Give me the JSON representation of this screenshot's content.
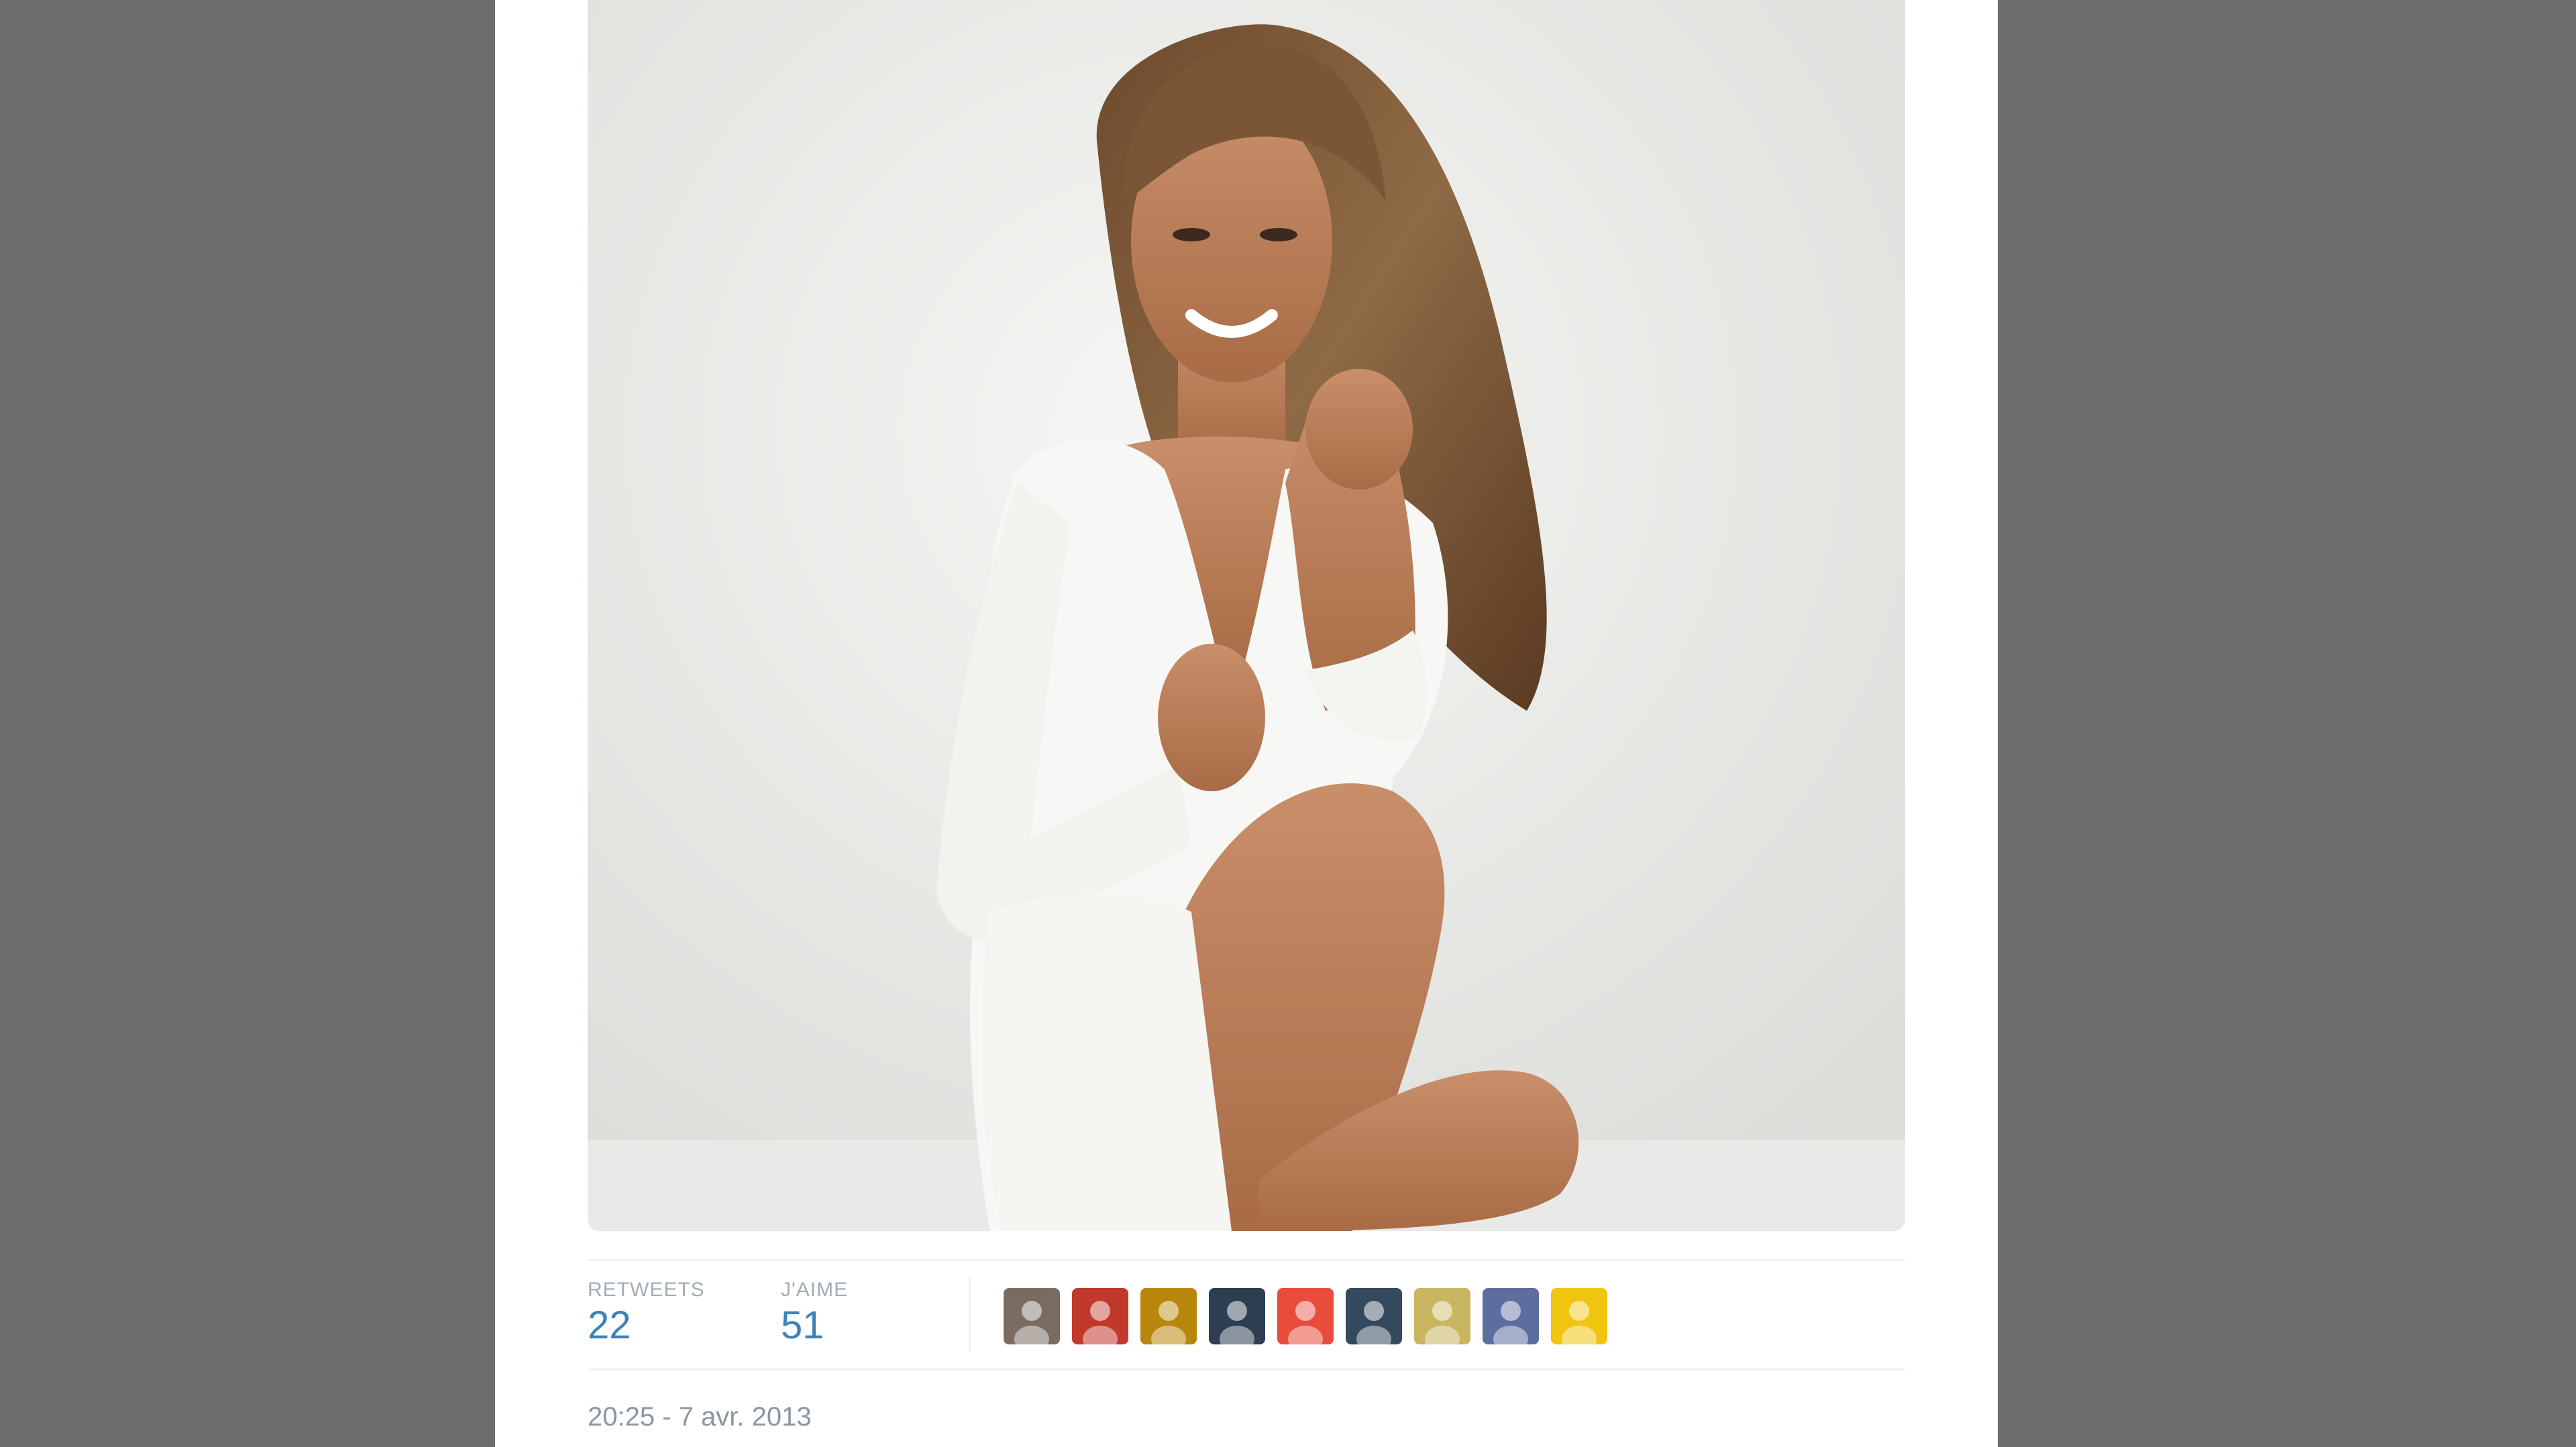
{
  "tweet": {
    "stats": {
      "retweets_label": "RETWEETS",
      "retweets_value": "22",
      "likes_label": "J'AIME",
      "likes_value": "51"
    },
    "liked_by_avatars": [
      {
        "icon": "user-avatar-icon",
        "color": "#7b6c62"
      },
      {
        "icon": "user-avatar-icon",
        "color": "#c0392b"
      },
      {
        "icon": "user-avatar-icon",
        "color": "#b8860b"
      },
      {
        "icon": "user-avatar-icon",
        "color": "#2c3e50"
      },
      {
        "icon": "user-avatar-icon",
        "color": "#e74c3c"
      },
      {
        "icon": "user-avatar-icon",
        "color": "#34495e"
      },
      {
        "icon": "user-avatar-icon",
        "color": "#c8b560"
      },
      {
        "icon": "user-avatar-icon",
        "color": "#5d6d9e"
      },
      {
        "icon": "user-avatar-icon",
        "color": "#f1c40f"
      }
    ],
    "timestamp": "20:25 - 7 avr. 2013"
  },
  "colors": {
    "background": "#6b6e6c",
    "card": "#ffffff",
    "link_blue": "#3d82b9",
    "muted_text": "#8b979f"
  }
}
